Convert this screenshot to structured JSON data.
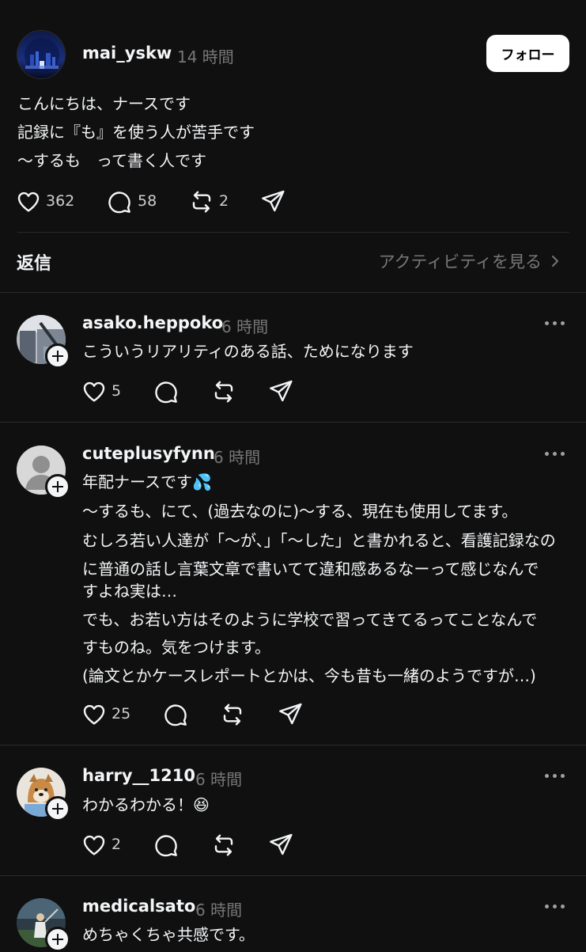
{
  "post": {
    "username": "mai_yskw",
    "time": "14 時間",
    "follow_label": "フォロー",
    "lines": [
      "こんにちは、ナースです",
      "記録に『も』を使う人が苦手です",
      "〜するも　って書く人です"
    ],
    "likes": "362",
    "replies": "58",
    "reposts": "2"
  },
  "replies_header": {
    "title": "返信",
    "activity_label": "アクティビティを見る"
  },
  "replies": [
    {
      "username": "asako.heppoko",
      "time": "6 時間",
      "lines": [
        "こういうリアリティのある話、ためになります"
      ],
      "likes": "5"
    },
    {
      "username": "cuteplusyfynn",
      "time": "6 時間",
      "lines": [
        "年配ナースです💦",
        "〜するも、にて、(過去なのに)〜する、現在も使用してます。",
        "むしろ若い人達が「〜が、」「〜した」と書かれると、看護記録なの",
        "に普通の話し言葉文章で書いてて違和感あるなーって感じなんで",
        "すよね実は…",
        "でも、お若い方はそのように学校で習ってきてるってことなんで",
        "すものね。気をつけます。",
        "(論文とかケースレポートとかは、今も昔も一緒のようですが…)"
      ],
      "likes": "25"
    },
    {
      "username": "harry__1210",
      "time": "6 時間",
      "lines": [
        "わかるわかる！😆"
      ],
      "likes": "2"
    },
    {
      "username": "medicalsato",
      "time": "6 時間",
      "lines": [
        "めちゃくちゃ共感です。"
      ],
      "likes": ""
    }
  ],
  "icons": {
    "like": "heart-icon",
    "reply": "comment-icon",
    "repost": "repost-icon",
    "share": "send-icon",
    "more": "more-dots-icon",
    "chevron": "chevron-right-icon",
    "follow_plus": "plus-icon"
  },
  "colors": {
    "background": "#101010",
    "text": "#f3f5f7",
    "secondary": "#777777",
    "divider": "#2a2a2a"
  }
}
